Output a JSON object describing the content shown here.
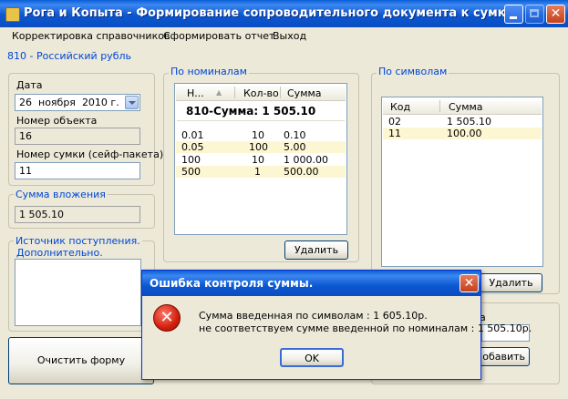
{
  "window": {
    "title": "Рога и Копыта - Формирование сопроводительного документа к сумке",
    "minimize_glyph": "",
    "close_glyph": "✕"
  },
  "menu": [
    "Корректировка справочников",
    "Сформировать отчет",
    "Выход"
  ],
  "currency_label": "810 - Российский рубль",
  "left": {
    "date_label": "Дата",
    "date_day": "26",
    "date_month": "ноября",
    "date_year": "2010 г.",
    "object_number_label": "Номер объекта",
    "object_number_value": "16",
    "bag_number_label": "Номер сумки (сейф-пакета)",
    "bag_number_value": "11",
    "deposit_sum_label": "Сумма вложения",
    "deposit_sum_value": "1 505.10",
    "source_label_line1": "Источник поступления.",
    "source_label_line2": "Дополнительно.",
    "source_value": "",
    "clear_button": "Очистить форму"
  },
  "denominations": {
    "group_label": "По номиналам",
    "columns": [
      "Н...",
      "Кол-во",
      "Сумма"
    ],
    "total_label": "810-Сумма: 1 505.10",
    "rows": [
      {
        "nominal": "0.01",
        "count": "10",
        "sum": "0.10"
      },
      {
        "nominal": "0.05",
        "count": "100",
        "sum": "5.00"
      },
      {
        "nominal": "100",
        "count": "10",
        "sum": "1 000.00"
      },
      {
        "nominal": "500",
        "count": "1",
        "sum": "500.00"
      }
    ],
    "delete_button": "Удалить"
  },
  "symbols": {
    "group_label": "По символам",
    "columns": [
      "Код",
      "Сумма"
    ],
    "rows": [
      {
        "code": "02",
        "sum": "1 505.10"
      },
      {
        "code": "11",
        "sum": "100.00"
      }
    ],
    "delete_button": "Удалить",
    "partial_label": "а",
    "add_button_partial": "обавить"
  },
  "dialog": {
    "title": "Ошибка контроля суммы.",
    "message_line1": "Сумма введенная по символам : 1 605.10р.",
    "message_line2": "не соответствуем сумме введенной по номиналам : 1 505.10р.",
    "ok_button": "OK",
    "close_glyph": "✕",
    "error_glyph": "✕"
  },
  "colors": {
    "accent_blue": "#0046d5",
    "title_blue": "#0a5fd8",
    "row_highlight": "#fdf6d2",
    "window_bg": "#ece9d8"
  }
}
